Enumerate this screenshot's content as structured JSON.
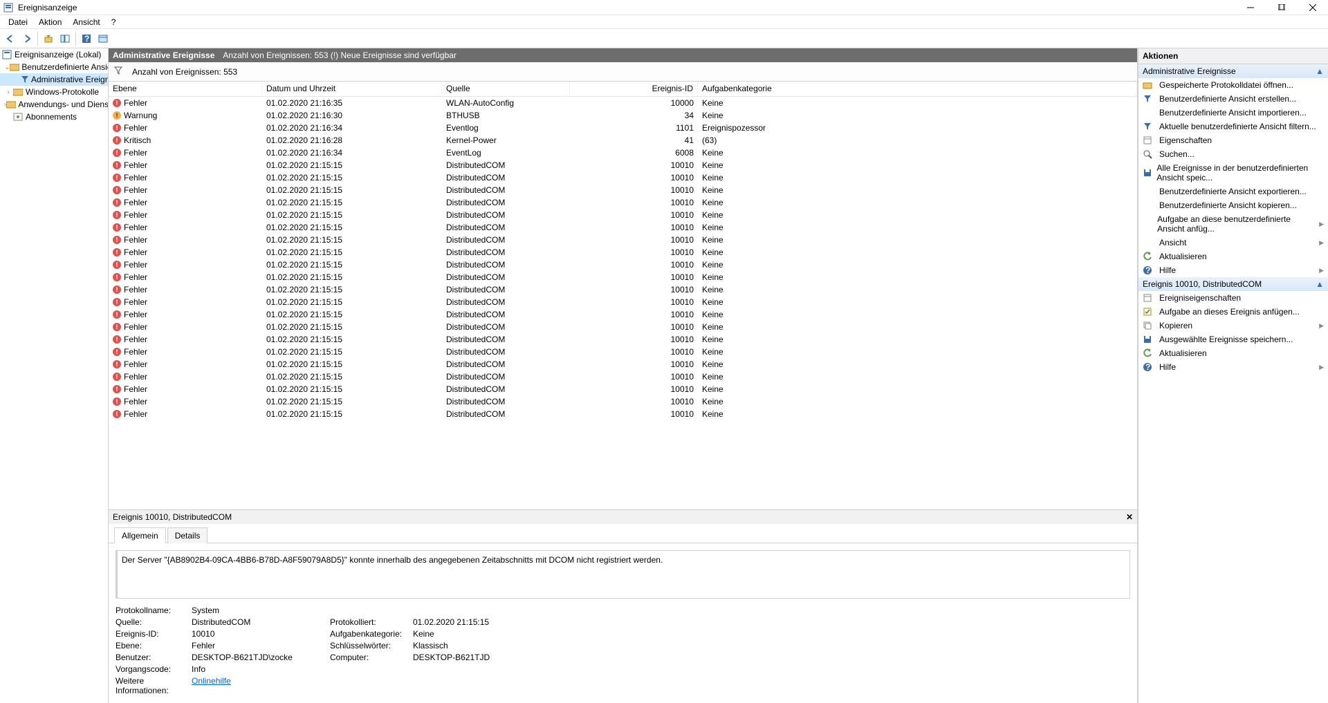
{
  "window": {
    "title": "Ereignisanzeige"
  },
  "menu": {
    "file": "Datei",
    "action": "Aktion",
    "view": "Ansicht",
    "help": "?"
  },
  "tree": {
    "root": "Ereignisanzeige (Lokal)",
    "custom_views": "Benutzerdefinierte Ansichten",
    "admin_events": "Administrative Ereignisse",
    "windows_logs": "Windows-Protokolle",
    "app_service": "Anwendungs- und Dienstprotokolle",
    "subscriptions": "Abonnements"
  },
  "center": {
    "title": "Administrative Ereignisse",
    "subtitle": "Anzahl von Ereignissen: 553 (!) Neue Ereignisse sind verfügbar",
    "filter_label": "Anzahl von Ereignissen: 553",
    "cols": {
      "level": "Ebene",
      "date": "Datum und Uhrzeit",
      "source": "Quelle",
      "id": "Ereignis-ID",
      "cat": "Aufgabenkategorie"
    }
  },
  "events": [
    {
      "level": "Fehler",
      "lt": "error",
      "date": "01.02.2020 21:16:35",
      "src": "WLAN-AutoConfig",
      "id": "10000",
      "cat": "Keine"
    },
    {
      "level": "Warnung",
      "lt": "warn",
      "date": "01.02.2020 21:16:30",
      "src": "BTHUSB",
      "id": "34",
      "cat": "Keine"
    },
    {
      "level": "Fehler",
      "lt": "error",
      "date": "01.02.2020 21:16:34",
      "src": "Eventlog",
      "id": "1101",
      "cat": "Ereignispozessor"
    },
    {
      "level": "Kritisch",
      "lt": "crit",
      "date": "01.02.2020 21:16:28",
      "src": "Kernel-Power",
      "id": "41",
      "cat": "(63)"
    },
    {
      "level": "Fehler",
      "lt": "error",
      "date": "01.02.2020 21:16:34",
      "src": "EventLog",
      "id": "6008",
      "cat": "Keine"
    },
    {
      "level": "Fehler",
      "lt": "error",
      "date": "01.02.2020 21:15:15",
      "src": "DistributedCOM",
      "id": "10010",
      "cat": "Keine"
    },
    {
      "level": "Fehler",
      "lt": "error",
      "date": "01.02.2020 21:15:15",
      "src": "DistributedCOM",
      "id": "10010",
      "cat": "Keine"
    },
    {
      "level": "Fehler",
      "lt": "error",
      "date": "01.02.2020 21:15:15",
      "src": "DistributedCOM",
      "id": "10010",
      "cat": "Keine"
    },
    {
      "level": "Fehler",
      "lt": "error",
      "date": "01.02.2020 21:15:15",
      "src": "DistributedCOM",
      "id": "10010",
      "cat": "Keine"
    },
    {
      "level": "Fehler",
      "lt": "error",
      "date": "01.02.2020 21:15:15",
      "src": "DistributedCOM",
      "id": "10010",
      "cat": "Keine"
    },
    {
      "level": "Fehler",
      "lt": "error",
      "date": "01.02.2020 21:15:15",
      "src": "DistributedCOM",
      "id": "10010",
      "cat": "Keine"
    },
    {
      "level": "Fehler",
      "lt": "error",
      "date": "01.02.2020 21:15:15",
      "src": "DistributedCOM",
      "id": "10010",
      "cat": "Keine"
    },
    {
      "level": "Fehler",
      "lt": "error",
      "date": "01.02.2020 21:15:15",
      "src": "DistributedCOM",
      "id": "10010",
      "cat": "Keine"
    },
    {
      "level": "Fehler",
      "lt": "error",
      "date": "01.02.2020 21:15:15",
      "src": "DistributedCOM",
      "id": "10010",
      "cat": "Keine"
    },
    {
      "level": "Fehler",
      "lt": "error",
      "date": "01.02.2020 21:15:15",
      "src": "DistributedCOM",
      "id": "10010",
      "cat": "Keine"
    },
    {
      "level": "Fehler",
      "lt": "error",
      "date": "01.02.2020 21:15:15",
      "src": "DistributedCOM",
      "id": "10010",
      "cat": "Keine"
    },
    {
      "level": "Fehler",
      "lt": "error",
      "date": "01.02.2020 21:15:15",
      "src": "DistributedCOM",
      "id": "10010",
      "cat": "Keine"
    },
    {
      "level": "Fehler",
      "lt": "error",
      "date": "01.02.2020 21:15:15",
      "src": "DistributedCOM",
      "id": "10010",
      "cat": "Keine"
    },
    {
      "level": "Fehler",
      "lt": "error",
      "date": "01.02.2020 21:15:15",
      "src": "DistributedCOM",
      "id": "10010",
      "cat": "Keine"
    },
    {
      "level": "Fehler",
      "lt": "error",
      "date": "01.02.2020 21:15:15",
      "src": "DistributedCOM",
      "id": "10010",
      "cat": "Keine"
    },
    {
      "level": "Fehler",
      "lt": "error",
      "date": "01.02.2020 21:15:15",
      "src": "DistributedCOM",
      "id": "10010",
      "cat": "Keine"
    },
    {
      "level": "Fehler",
      "lt": "error",
      "date": "01.02.2020 21:15:15",
      "src": "DistributedCOM",
      "id": "10010",
      "cat": "Keine"
    },
    {
      "level": "Fehler",
      "lt": "error",
      "date": "01.02.2020 21:15:15",
      "src": "DistributedCOM",
      "id": "10010",
      "cat": "Keine"
    },
    {
      "level": "Fehler",
      "lt": "error",
      "date": "01.02.2020 21:15:15",
      "src": "DistributedCOM",
      "id": "10010",
      "cat": "Keine"
    },
    {
      "level": "Fehler",
      "lt": "error",
      "date": "01.02.2020 21:15:15",
      "src": "DistributedCOM",
      "id": "10010",
      "cat": "Keine"
    },
    {
      "level": "Fehler",
      "lt": "error",
      "date": "01.02.2020 21:15:15",
      "src": "DistributedCOM",
      "id": "10010",
      "cat": "Keine"
    }
  ],
  "detail": {
    "header": "Ereignis 10010, DistributedCOM",
    "tab_general": "Allgemein",
    "tab_details": "Details",
    "message": "Der Server \"{AB8902B4-09CA-4BB6-B78D-A8F59079A8D5}\" konnte innerhalb des angegebenen Zeitabschnitts mit DCOM nicht registriert werden.",
    "labels": {
      "logname": "Protokollname:",
      "source": "Quelle:",
      "logged": "Protokolliert:",
      "eventid": "Ereignis-ID:",
      "taskcat": "Aufgabenkategorie:",
      "level": "Ebene:",
      "keywords": "Schlüsselwörter:",
      "user": "Benutzer:",
      "computer": "Computer:",
      "opcode": "Vorgangscode:",
      "moreinfo": "Weitere Informationen:"
    },
    "values": {
      "logname": "System",
      "source": "DistributedCOM",
      "logged": "01.02.2020 21:15:15",
      "eventid": "10010",
      "taskcat": "Keine",
      "level": "Fehler",
      "keywords": "Klassisch",
      "user": "DESKTOP-B621TJD\\zocke",
      "computer": "DESKTOP-B621TJD",
      "opcode": "Info",
      "onlinehelp": "Onlinehilfe"
    }
  },
  "actions": {
    "title": "Aktionen",
    "sec1": "Administrative Ereignisse",
    "sec2": "Ereignis 10010, DistributedCOM",
    "items1": [
      {
        "icon": "open",
        "label": "Gespeicherte Protokolldatei öffnen..."
      },
      {
        "icon": "filter",
        "label": "Benutzerdefinierte Ansicht erstellen..."
      },
      {
        "icon": "",
        "label": "Benutzerdefinierte Ansicht importieren..."
      },
      {
        "icon": "filter",
        "label": "Aktuelle benutzerdefinierte Ansicht filtern..."
      },
      {
        "icon": "props",
        "label": "Eigenschaften"
      },
      {
        "icon": "find",
        "label": "Suchen..."
      },
      {
        "icon": "save",
        "label": "Alle Ereignisse in der benutzerdefinierten Ansicht speic..."
      },
      {
        "icon": "",
        "label": "Benutzerdefinierte Ansicht exportieren..."
      },
      {
        "icon": "",
        "label": "Benutzerdefinierte Ansicht kopieren..."
      },
      {
        "icon": "",
        "label": "Aufgabe an diese benutzerdefinierte Ansicht anfüg...",
        "more": true
      },
      {
        "icon": "",
        "label": "Ansicht",
        "more": true
      },
      {
        "icon": "refresh",
        "label": "Aktualisieren"
      },
      {
        "icon": "help",
        "label": "Hilfe",
        "more": true
      }
    ],
    "items2": [
      {
        "icon": "props",
        "label": "Ereigniseigenschaften"
      },
      {
        "icon": "task",
        "label": "Aufgabe an dieses Ereignis anfügen..."
      },
      {
        "icon": "copy",
        "label": "Kopieren",
        "more": true
      },
      {
        "icon": "save",
        "label": "Ausgewählte Ereignisse speichern..."
      },
      {
        "icon": "refresh",
        "label": "Aktualisieren"
      },
      {
        "icon": "help",
        "label": "Hilfe",
        "more": true
      }
    ]
  }
}
